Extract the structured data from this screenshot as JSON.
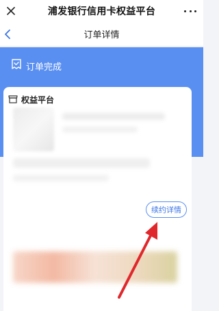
{
  "appbar": {
    "title": "浦发银行信用卡权益平台",
    "close_icon": "close-icon",
    "more_icon": "more-icon"
  },
  "navbar": {
    "title": "订单详情",
    "back_icon": "chevron-left-icon"
  },
  "status": {
    "label": "订单完成",
    "icon": "order-done-icon"
  },
  "card": {
    "title": "权益平台",
    "icon": "store-icon",
    "renewal_button": "续约详情"
  },
  "colors": {
    "accent_blue": "#5a8ff2",
    "button_text": "#3b75e6",
    "arrow_red": "#e0282c"
  }
}
